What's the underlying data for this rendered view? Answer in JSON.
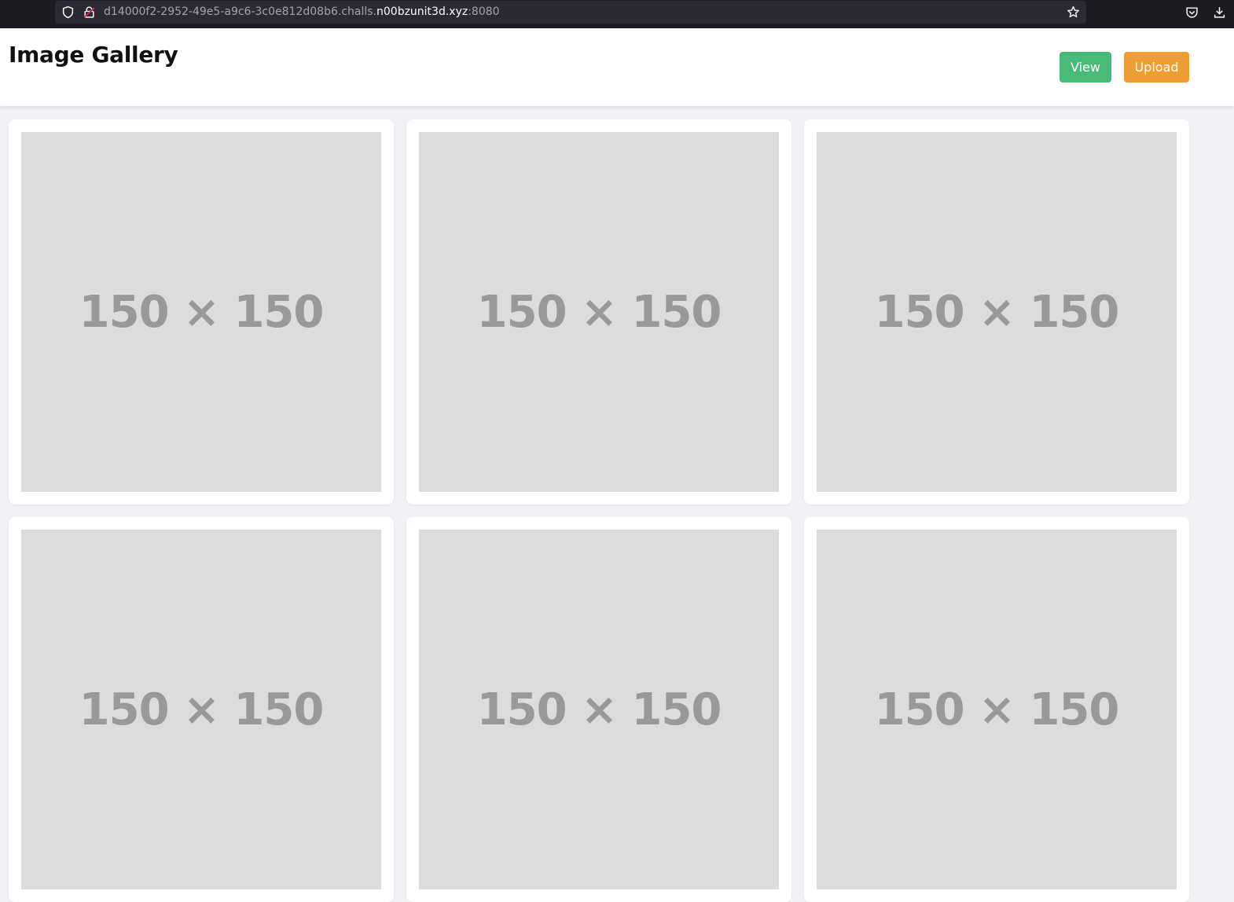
{
  "browser": {
    "url_prefix": "d14000f2-2952-49e5-a9c6-3c0e812d08b6.challs.",
    "url_domain": "n00bzunit3d.xyz",
    "url_port": ":8080"
  },
  "header": {
    "title": "Image Gallery",
    "view_label": "View",
    "upload_label": "Upload"
  },
  "gallery": {
    "images": [
      {
        "placeholder": "150 × 150"
      },
      {
        "placeholder": "150 × 150"
      },
      {
        "placeholder": "150 × 150"
      },
      {
        "placeholder": "150 × 150"
      },
      {
        "placeholder": "150 × 150"
      },
      {
        "placeholder": "150 × 150"
      }
    ]
  },
  "colors": {
    "view_button": "#48bb78",
    "upload_button": "#ed9e34",
    "placeholder_bg": "#dcdcdc",
    "placeholder_text": "#999999"
  }
}
